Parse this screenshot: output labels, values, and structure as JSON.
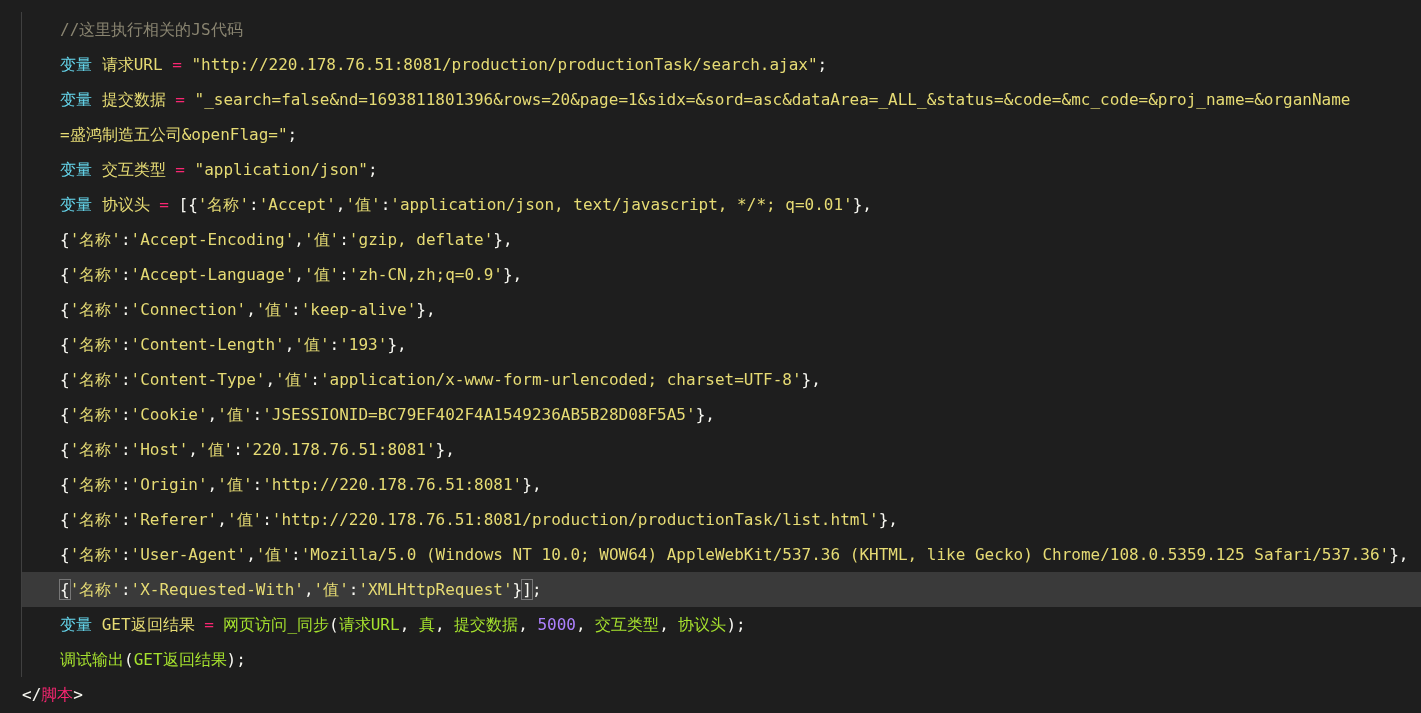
{
  "script_block": {
    "body": [
      {
        "current": false,
        "tokens": [
          {
            "kind": "comment",
            "text": "//这里执行相关的JS代码"
          }
        ]
      },
      {
        "current": false,
        "tokens": [
          {
            "kind": "keyword",
            "text": "变量"
          },
          {
            "kind": "ident",
            "text": " 请求URL "
          },
          {
            "kind": "operator",
            "text": "="
          },
          {
            "kind": "string",
            "text": " \"http://220.178.76.51:8081/production/productionTask/search.ajax\""
          },
          {
            "kind": "punct",
            "text": ";"
          }
        ]
      },
      {
        "current": false,
        "tokens": [
          {
            "kind": "keyword",
            "text": "变量"
          },
          {
            "kind": "ident",
            "text": " 提交数据 "
          },
          {
            "kind": "operator",
            "text": "="
          },
          {
            "kind": "string",
            "text": " \"_search=false&nd=1693811801396&rows=20&page=1&sidx=&sord=asc&dataArea=_ALL_&status=&code=&mc_code=&proj_name=&organName"
          }
        ]
      },
      {
        "current": false,
        "tokens": [
          {
            "kind": "string",
            "text": "=盛鸿制造五公司&openFlag=\""
          },
          {
            "kind": "punct",
            "text": ";"
          }
        ]
      },
      {
        "current": false,
        "tokens": [
          {
            "kind": "keyword",
            "text": "变量"
          },
          {
            "kind": "ident",
            "text": " 交互类型 "
          },
          {
            "kind": "operator",
            "text": "="
          },
          {
            "kind": "string",
            "text": " \"application/json\""
          },
          {
            "kind": "punct",
            "text": ";"
          }
        ]
      },
      {
        "current": false,
        "tokens": [
          {
            "kind": "keyword",
            "text": "变量"
          },
          {
            "kind": "ident",
            "text": " 协议头 "
          },
          {
            "kind": "operator",
            "text": "="
          },
          {
            "kind": "punct",
            "text": " [{"
          },
          {
            "kind": "string",
            "text": "'名称'"
          },
          {
            "kind": "punct",
            "text": ":"
          },
          {
            "kind": "string",
            "text": "'Accept'"
          },
          {
            "kind": "punct",
            "text": ","
          },
          {
            "kind": "string",
            "text": "'值'"
          },
          {
            "kind": "punct",
            "text": ":"
          },
          {
            "kind": "string",
            "text": "'application/json, text/javascript, */*; q=0.01'"
          },
          {
            "kind": "punct",
            "text": "},"
          }
        ]
      },
      {
        "current": false,
        "tokens": [
          {
            "kind": "punct",
            "text": "{"
          },
          {
            "kind": "string",
            "text": "'名称'"
          },
          {
            "kind": "punct",
            "text": ":"
          },
          {
            "kind": "string",
            "text": "'Accept-Encoding'"
          },
          {
            "kind": "punct",
            "text": ","
          },
          {
            "kind": "string",
            "text": "'值'"
          },
          {
            "kind": "punct",
            "text": ":"
          },
          {
            "kind": "string",
            "text": "'gzip, deflate'"
          },
          {
            "kind": "punct",
            "text": "},"
          }
        ]
      },
      {
        "current": false,
        "tokens": [
          {
            "kind": "punct",
            "text": "{"
          },
          {
            "kind": "string",
            "text": "'名称'"
          },
          {
            "kind": "punct",
            "text": ":"
          },
          {
            "kind": "string",
            "text": "'Accept-Language'"
          },
          {
            "kind": "punct",
            "text": ","
          },
          {
            "kind": "string",
            "text": "'值'"
          },
          {
            "kind": "punct",
            "text": ":"
          },
          {
            "kind": "string",
            "text": "'zh-CN,zh;q=0.9'"
          },
          {
            "kind": "punct",
            "text": "},"
          }
        ]
      },
      {
        "current": false,
        "tokens": [
          {
            "kind": "punct",
            "text": "{"
          },
          {
            "kind": "string",
            "text": "'名称'"
          },
          {
            "kind": "punct",
            "text": ":"
          },
          {
            "kind": "string",
            "text": "'Connection'"
          },
          {
            "kind": "punct",
            "text": ","
          },
          {
            "kind": "string",
            "text": "'值'"
          },
          {
            "kind": "punct",
            "text": ":"
          },
          {
            "kind": "string",
            "text": "'keep-alive'"
          },
          {
            "kind": "punct",
            "text": "},"
          }
        ]
      },
      {
        "current": false,
        "tokens": [
          {
            "kind": "punct",
            "text": "{"
          },
          {
            "kind": "string",
            "text": "'名称'"
          },
          {
            "kind": "punct",
            "text": ":"
          },
          {
            "kind": "string",
            "text": "'Content-Length'"
          },
          {
            "kind": "punct",
            "text": ","
          },
          {
            "kind": "string",
            "text": "'值'"
          },
          {
            "kind": "punct",
            "text": ":"
          },
          {
            "kind": "string",
            "text": "'193'"
          },
          {
            "kind": "punct",
            "text": "},"
          }
        ]
      },
      {
        "current": false,
        "tokens": [
          {
            "kind": "punct",
            "text": "{"
          },
          {
            "kind": "string",
            "text": "'名称'"
          },
          {
            "kind": "punct",
            "text": ":"
          },
          {
            "kind": "string",
            "text": "'Content-Type'"
          },
          {
            "kind": "punct",
            "text": ","
          },
          {
            "kind": "string",
            "text": "'值'"
          },
          {
            "kind": "punct",
            "text": ":"
          },
          {
            "kind": "string",
            "text": "'application/x-www-form-urlencoded; charset=UTF-8'"
          },
          {
            "kind": "punct",
            "text": "},"
          }
        ]
      },
      {
        "current": false,
        "tokens": [
          {
            "kind": "punct",
            "text": "{"
          },
          {
            "kind": "string",
            "text": "'名称'"
          },
          {
            "kind": "punct",
            "text": ":"
          },
          {
            "kind": "string",
            "text": "'Cookie'"
          },
          {
            "kind": "punct",
            "text": ","
          },
          {
            "kind": "string",
            "text": "'值'"
          },
          {
            "kind": "punct",
            "text": ":"
          },
          {
            "kind": "string",
            "text": "'JSESSIONID=BC79EF402F4A1549236AB5B28D08F5A5'"
          },
          {
            "kind": "punct",
            "text": "},"
          }
        ]
      },
      {
        "current": false,
        "tokens": [
          {
            "kind": "punct",
            "text": "{"
          },
          {
            "kind": "string",
            "text": "'名称'"
          },
          {
            "kind": "punct",
            "text": ":"
          },
          {
            "kind": "string",
            "text": "'Host'"
          },
          {
            "kind": "punct",
            "text": ","
          },
          {
            "kind": "string",
            "text": "'值'"
          },
          {
            "kind": "punct",
            "text": ":"
          },
          {
            "kind": "string",
            "text": "'220.178.76.51:8081'"
          },
          {
            "kind": "punct",
            "text": "},"
          }
        ]
      },
      {
        "current": false,
        "tokens": [
          {
            "kind": "punct",
            "text": "{"
          },
          {
            "kind": "string",
            "text": "'名称'"
          },
          {
            "kind": "punct",
            "text": ":"
          },
          {
            "kind": "string",
            "text": "'Origin'"
          },
          {
            "kind": "punct",
            "text": ","
          },
          {
            "kind": "string",
            "text": "'值'"
          },
          {
            "kind": "punct",
            "text": ":"
          },
          {
            "kind": "string",
            "text": "'http://220.178.76.51:8081'"
          },
          {
            "kind": "punct",
            "text": "},"
          }
        ]
      },
      {
        "current": false,
        "tokens": [
          {
            "kind": "punct",
            "text": "{"
          },
          {
            "kind": "string",
            "text": "'名称'"
          },
          {
            "kind": "punct",
            "text": ":"
          },
          {
            "kind": "string",
            "text": "'Referer'"
          },
          {
            "kind": "punct",
            "text": ","
          },
          {
            "kind": "string",
            "text": "'值'"
          },
          {
            "kind": "punct",
            "text": ":"
          },
          {
            "kind": "string",
            "text": "'http://220.178.76.51:8081/production/productionTask/list.html'"
          },
          {
            "kind": "punct",
            "text": "},"
          }
        ]
      },
      {
        "current": false,
        "tokens": [
          {
            "kind": "punct",
            "text": "{"
          },
          {
            "kind": "string",
            "text": "'名称'"
          },
          {
            "kind": "punct",
            "text": ":"
          },
          {
            "kind": "string",
            "text": "'User-Agent'"
          },
          {
            "kind": "punct",
            "text": ","
          },
          {
            "kind": "string",
            "text": "'值'"
          },
          {
            "kind": "punct",
            "text": ":"
          },
          {
            "kind": "string",
            "text": "'Mozilla/5.0 (Windows NT 10.0; WOW64) AppleWebKit/537.36 (KHTML, like Gecko) Chrome/108.0.5359.125 Safari/537.36'"
          },
          {
            "kind": "punct",
            "text": "},"
          }
        ]
      },
      {
        "current": true,
        "tokens": [
          {
            "kind": "bracket",
            "text": "{",
            "matched": true
          },
          {
            "kind": "string",
            "text": "'名称'"
          },
          {
            "kind": "punct",
            "text": ":"
          },
          {
            "kind": "string",
            "text": "'X-Requested-With'"
          },
          {
            "kind": "punct",
            "text": ","
          },
          {
            "kind": "string",
            "text": "'值'"
          },
          {
            "kind": "punct",
            "text": ":"
          },
          {
            "kind": "string",
            "text": "'XMLHttpRequest'"
          },
          {
            "kind": "punct",
            "text": "}"
          },
          {
            "kind": "bracket",
            "text": "]",
            "matched": true
          },
          {
            "kind": "punct",
            "text": ";"
          }
        ]
      },
      {
        "current": false,
        "tokens": [
          {
            "kind": "keyword",
            "text": "变量"
          },
          {
            "kind": "ident",
            "text": " GET返回结果 "
          },
          {
            "kind": "operator",
            "text": "="
          },
          {
            "kind": "function",
            "text": " 网页访问_同步"
          },
          {
            "kind": "punct",
            "text": "("
          },
          {
            "kind": "function",
            "text": "请求URL"
          },
          {
            "kind": "punct",
            "text": ", "
          },
          {
            "kind": "function",
            "text": "真"
          },
          {
            "kind": "punct",
            "text": ", "
          },
          {
            "kind": "function",
            "text": "提交数据"
          },
          {
            "kind": "punct",
            "text": ", "
          },
          {
            "kind": "number",
            "text": "5000"
          },
          {
            "kind": "punct",
            "text": ", "
          },
          {
            "kind": "function",
            "text": "交互类型"
          },
          {
            "kind": "punct",
            "text": ", "
          },
          {
            "kind": "function",
            "text": "协议头"
          },
          {
            "kind": "punct",
            "text": ");"
          }
        ]
      },
      {
        "current": false,
        "tokens": [
          {
            "kind": "function",
            "text": "调试输出"
          },
          {
            "kind": "punct",
            "text": "("
          },
          {
            "kind": "function",
            "text": "GET返回结果"
          },
          {
            "kind": "punct",
            "text": ");"
          }
        ]
      }
    ],
    "closing_tag": [
      {
        "kind": "punct",
        "text": "</"
      },
      {
        "kind": "tag",
        "text": "脚本"
      },
      {
        "kind": "punct",
        "text": ">"
      }
    ]
  }
}
